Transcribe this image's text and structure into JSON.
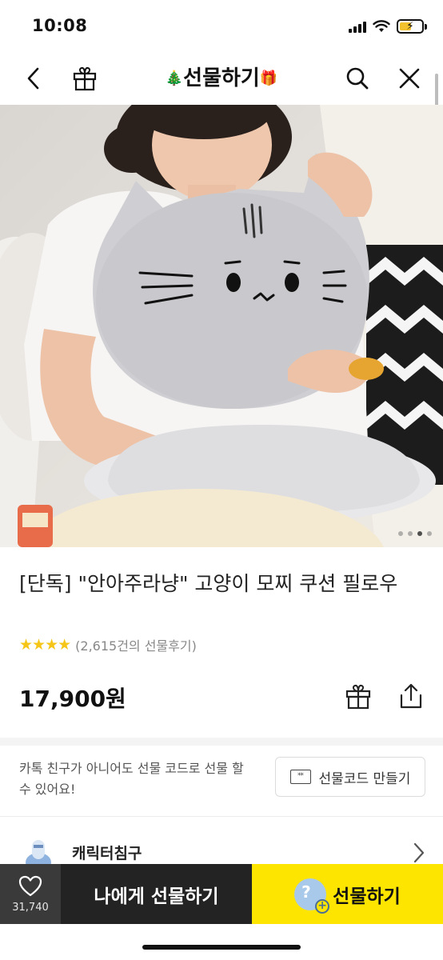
{
  "status_bar": {
    "time": "10:08"
  },
  "header": {
    "title": "선물하기"
  },
  "product": {
    "title": "[단독] \"안아주라냥\" 고양이 모찌 쿠션 필로우",
    "stars": "★★★★",
    "review_count": "(2,615건의 선물후기)",
    "price": "17,900원",
    "image_pages": 4,
    "active_image_page": 3
  },
  "gift_code": {
    "description": "카톡 친구가 아니어도 선물 코드로 선물 할 수 있어요!",
    "icon_text": "**",
    "button_label": "선물코드 만들기"
  },
  "brand": {
    "name": "캐릭터침구"
  },
  "bottom_bar": {
    "wish_count": "31,740",
    "gift_self_label": "나에게 선물하기",
    "gift_send_label": "선물하기",
    "friend_icon_text": "?",
    "accent": "#fde500"
  }
}
